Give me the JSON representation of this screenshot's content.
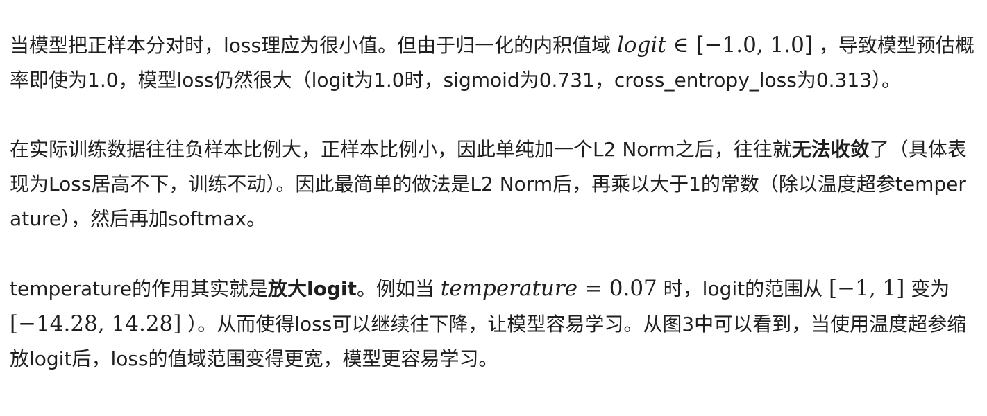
{
  "paragraphs": [
    {
      "t1": "当模型把正样本分对时，loss理应为很小值。但由于归一化的内积值域 ",
      "m1_var": "logit",
      "m1_rest": " ∈ [−1.0, 1.0]",
      "t2": " ，导致模型预估概率即使为1.0，模型loss仍然很大（logit为1.0时，sigmoid为0.731，cross_entropy_loss为0.313）。"
    },
    {
      "t1": "在实际训练数据往往负样本比例大，正样本比例小，因此单纯加一个L2 Norm之后，往往就",
      "bold1": "无法收敛",
      "t2": "了（具体表现为Loss居高不下，训练不动）。因此最简单的做法是L2 Norm后，再乘以大于1的常数（除以温度超参temperature），然后再加softmax。"
    },
    {
      "t1": "temperature的作用其实就是",
      "bold1": "放大logit",
      "t2": "。例如当 ",
      "m1_var": "temperature",
      "m1_rest": " = 0.07",
      "t3": " 时，logit的范围从 ",
      "m2": "[−1, 1]",
      "t4": " 变为 ",
      "m3": "[−14.28, 14.28]",
      "t5": " ）。从而使得loss可以继续往下降，让模型容易学习。从图3中可以看到，当使用温度超参缩放logit后，loss的值域范围变得更宽，模型更容易学习。"
    }
  ]
}
